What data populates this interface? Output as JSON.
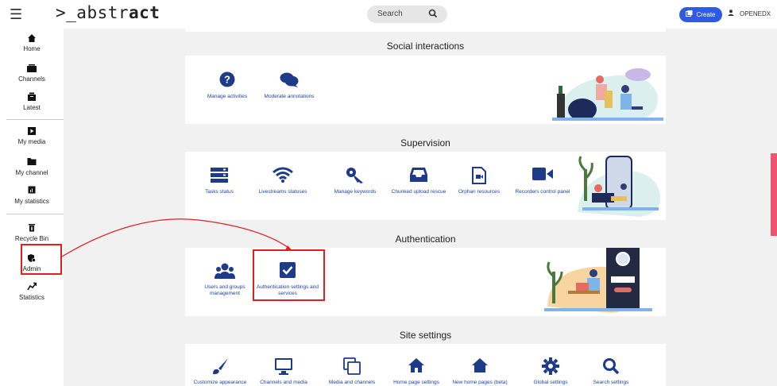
{
  "header": {
    "menu_icon": "hamburger-icon",
    "logo_prefix": ">_",
    "logo_text": "abstr",
    "logo_bold": "act",
    "search_placeholder": "Search",
    "create_label": "Create",
    "user_name": "OPENEDX"
  },
  "sidebar": {
    "items": [
      {
        "label": "Home",
        "icon": "home-icon"
      },
      {
        "label": "Channels",
        "icon": "channels-icon"
      },
      {
        "label": "Latest",
        "icon": "latest-icon"
      },
      {
        "label": "My media",
        "icon": "my-media-icon"
      },
      {
        "label": "My channel",
        "icon": "folder-icon"
      },
      {
        "label": "My statistics",
        "icon": "stats-icon"
      },
      {
        "label": "Recycle Bin",
        "icon": "trash-icon"
      },
      {
        "label": "Admin",
        "icon": "admin-icon"
      },
      {
        "label": "Statistics",
        "icon": "statistics-icon"
      }
    ]
  },
  "sections": {
    "social": {
      "title": "Social interactions",
      "tools": [
        "Manage activities",
        "Moderate annotations"
      ]
    },
    "supervision": {
      "title": "Supervision",
      "tools": [
        "Tasks status",
        "Livestreams statuses",
        "Manage keywords",
        "Chunked upload rescue",
        "Orphan resources",
        "Recorders control panel"
      ]
    },
    "authentication": {
      "title": "Authentication",
      "tools": [
        "Users and groups management",
        "Authentication settings and services"
      ]
    },
    "site": {
      "title": "Site settings",
      "tools": [
        "Customize appearance",
        "Channels and media",
        "Media and channels",
        "Home page settings",
        "New home pages (beta)",
        "Global settings",
        "Search settings"
      ]
    }
  },
  "colors": {
    "accent": "#2c5ce6",
    "tool_text": "#1a3fb0",
    "highlight": "#e02020",
    "icon_dark": "#1e3a8a"
  }
}
